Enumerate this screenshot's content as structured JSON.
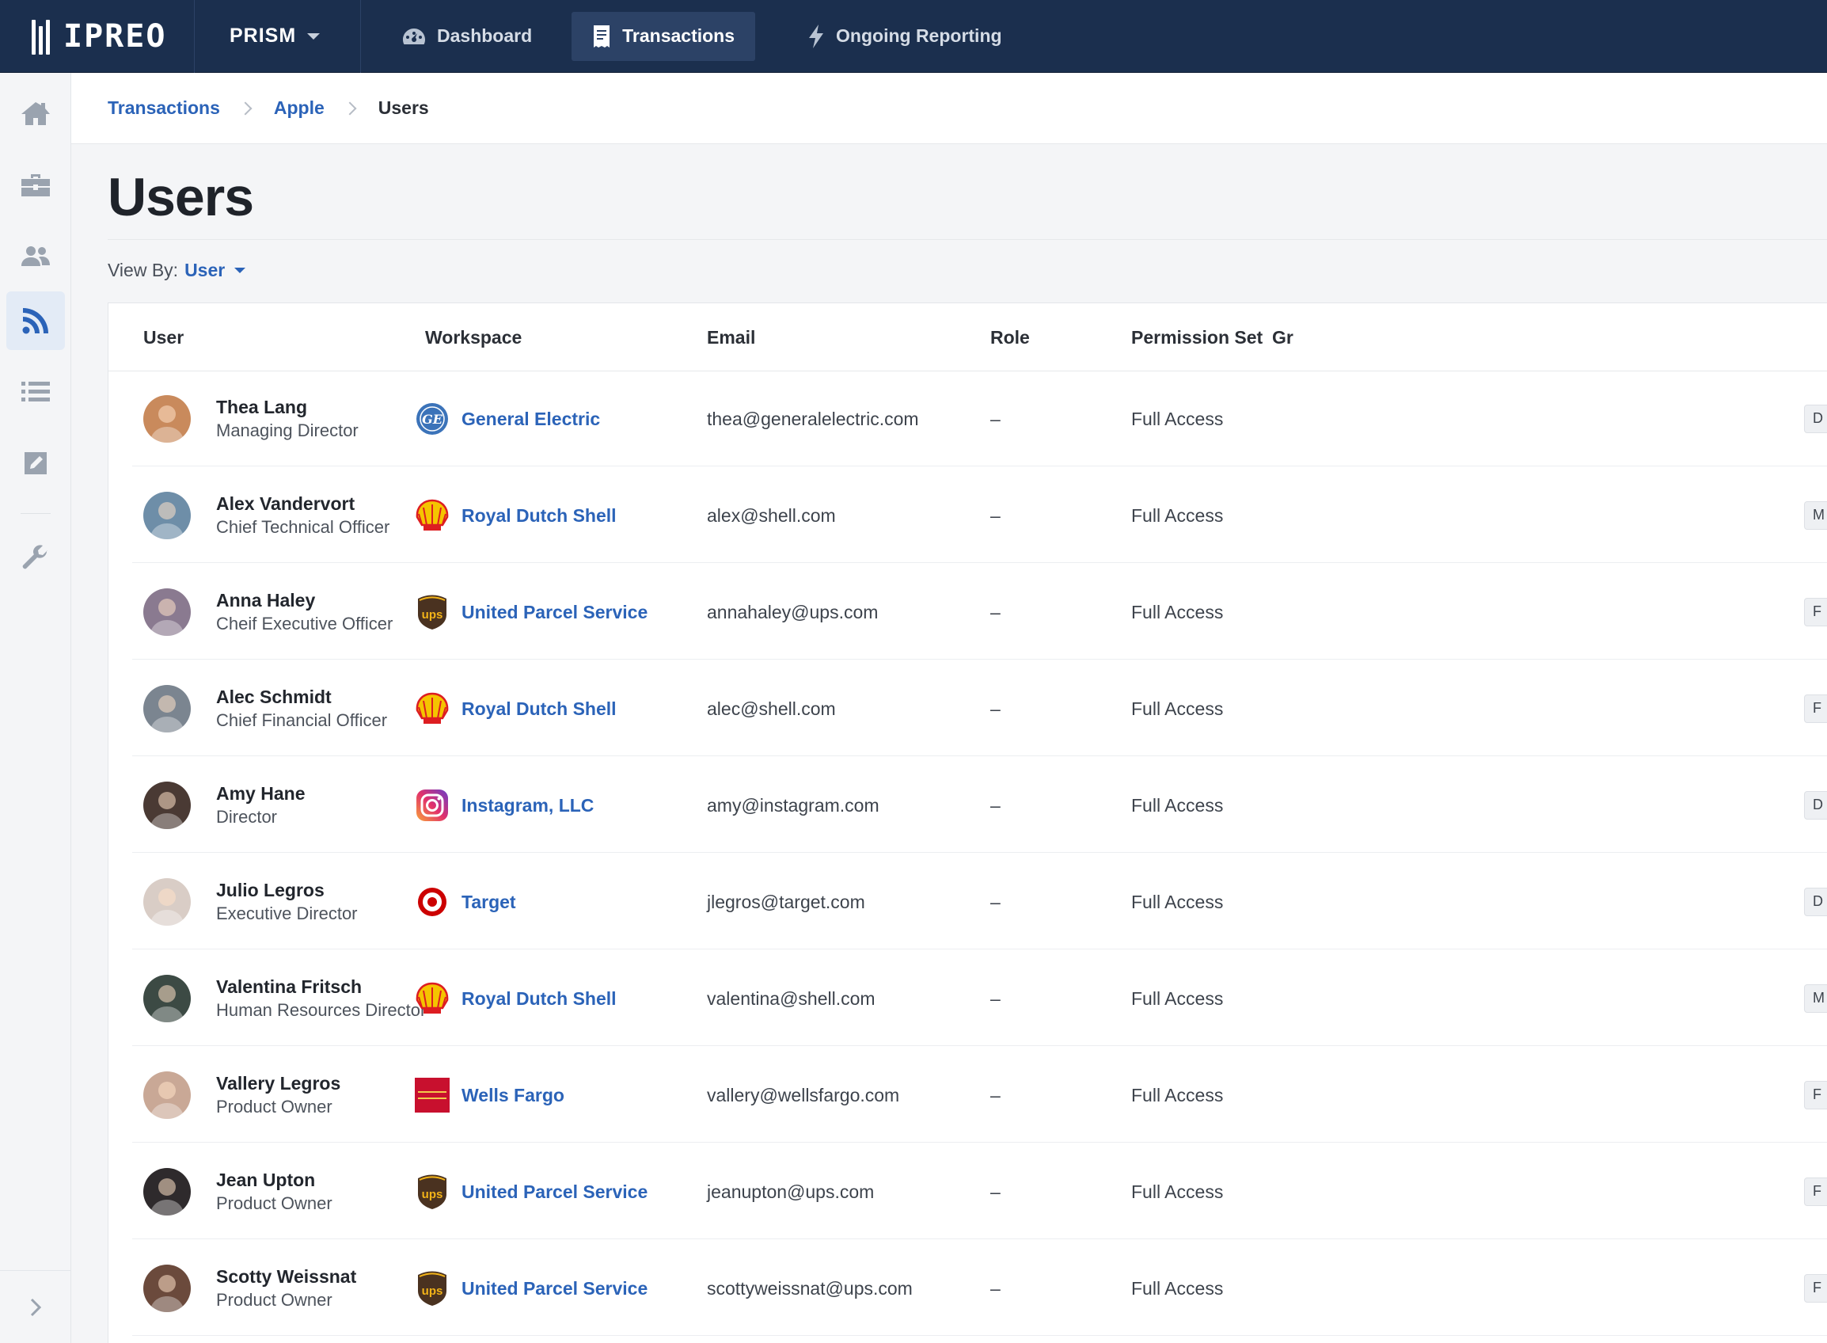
{
  "brand": {
    "name": "IPREO"
  },
  "topnav": {
    "product": "PRISM",
    "tabs": [
      {
        "label": "Dashboard",
        "icon": "dashboard-gauge-icon"
      },
      {
        "label": "Transactions",
        "icon": "receipt-icon",
        "active": true
      },
      {
        "label": "Ongoing Reporting",
        "icon": "lightning-icon"
      }
    ]
  },
  "rail": {
    "items": [
      "home-icon",
      "briefcase-icon",
      "users-icon",
      "feed-icon",
      "list-icon",
      "edit-icon",
      "wrench-icon"
    ],
    "active": "feed-icon",
    "expand_icon": "chevron-right-icon"
  },
  "breadcrumb": {
    "items": [
      "Transactions",
      "Apple"
    ],
    "current": "Users"
  },
  "page": {
    "title": "Users",
    "view_by_label": "View By:",
    "view_by_value": "User"
  },
  "table": {
    "columns": [
      "User",
      "Workspace",
      "Email",
      "Role",
      "Permission Set",
      "Gr"
    ],
    "rows": [
      {
        "name": "Thea Lang",
        "title": "Managing Director",
        "workspace": "General Electric",
        "logo": "ge",
        "email": "thea@generalelectric.com",
        "role": "–",
        "permission": "Full Access",
        "group": "D",
        "avatar": "#c98a5c"
      },
      {
        "name": "Alex Vandervort",
        "title": "Chief Technical Officer",
        "workspace": "Royal Dutch Shell",
        "logo": "shell",
        "email": "alex@shell.com",
        "role": "–",
        "permission": "Full Access",
        "group": "M",
        "avatar": "#6e8ea8"
      },
      {
        "name": "Anna Haley",
        "title": "Cheif Executive Officer",
        "workspace": "United Parcel Service",
        "logo": "ups",
        "email": "annahaley@ups.com",
        "role": "–",
        "permission": "Full Access",
        "group": "F",
        "avatar": "#8a7a90"
      },
      {
        "name": "Alec Schmidt",
        "title": "Chief Financial Officer",
        "workspace": "Royal Dutch Shell",
        "logo": "shell",
        "email": "alec@shell.com",
        "role": "–",
        "permission": "Full Access",
        "group": "F",
        "avatar": "#7b8590"
      },
      {
        "name": "Amy Hane",
        "title": "Director",
        "workspace": "Instagram, LLC",
        "logo": "instagram",
        "email": "amy@instagram.com",
        "role": "–",
        "permission": "Full Access",
        "group": "D",
        "avatar": "#4a3a34"
      },
      {
        "name": "Julio Legros",
        "title": "Executive Director",
        "workspace": "Target",
        "logo": "target",
        "email": "jlegros@target.com",
        "role": "–",
        "permission": "Full Access",
        "group": "D",
        "avatar": "#d9cdc6"
      },
      {
        "name": "Valentina Fritsch",
        "title": "Human Resources Director",
        "workspace": "Royal Dutch Shell",
        "logo": "shell",
        "email": "valentina@shell.com",
        "role": "–",
        "permission": "Full Access",
        "group": "M",
        "avatar": "#3c4a44"
      },
      {
        "name": "Vallery Legros",
        "title": "Product Owner",
        "workspace": "Wells Fargo",
        "logo": "wellsfargo",
        "email": "vallery@wellsfargo.com",
        "role": "–",
        "permission": "Full Access",
        "group": "F",
        "avatar": "#c9a896"
      },
      {
        "name": "Jean Upton",
        "title": "Product Owner",
        "workspace": "United Parcel Service",
        "logo": "ups",
        "email": "jeanupton@ups.com",
        "role": "–",
        "permission": "Full Access",
        "group": "F",
        "avatar": "#2e2a2c"
      },
      {
        "name": "Scotty Weissnat",
        "title": "Product Owner",
        "workspace": "United Parcel Service",
        "logo": "ups",
        "email": "scottyweissnat@ups.com",
        "role": "–",
        "permission": "Full Access",
        "group": "F",
        "avatar": "#6b4a3c"
      }
    ]
  },
  "colors": {
    "nav_bg": "#1b2f4e",
    "link": "#2b63b8",
    "shell_yellow": "#f5c400",
    "shell_red": "#dd1d21",
    "ups_brown": "#4a3220",
    "ups_gold": "#f2b318",
    "target_red": "#cc0000",
    "ge_blue": "#3b73b9",
    "wellsfargo_red": "#c8102e"
  }
}
